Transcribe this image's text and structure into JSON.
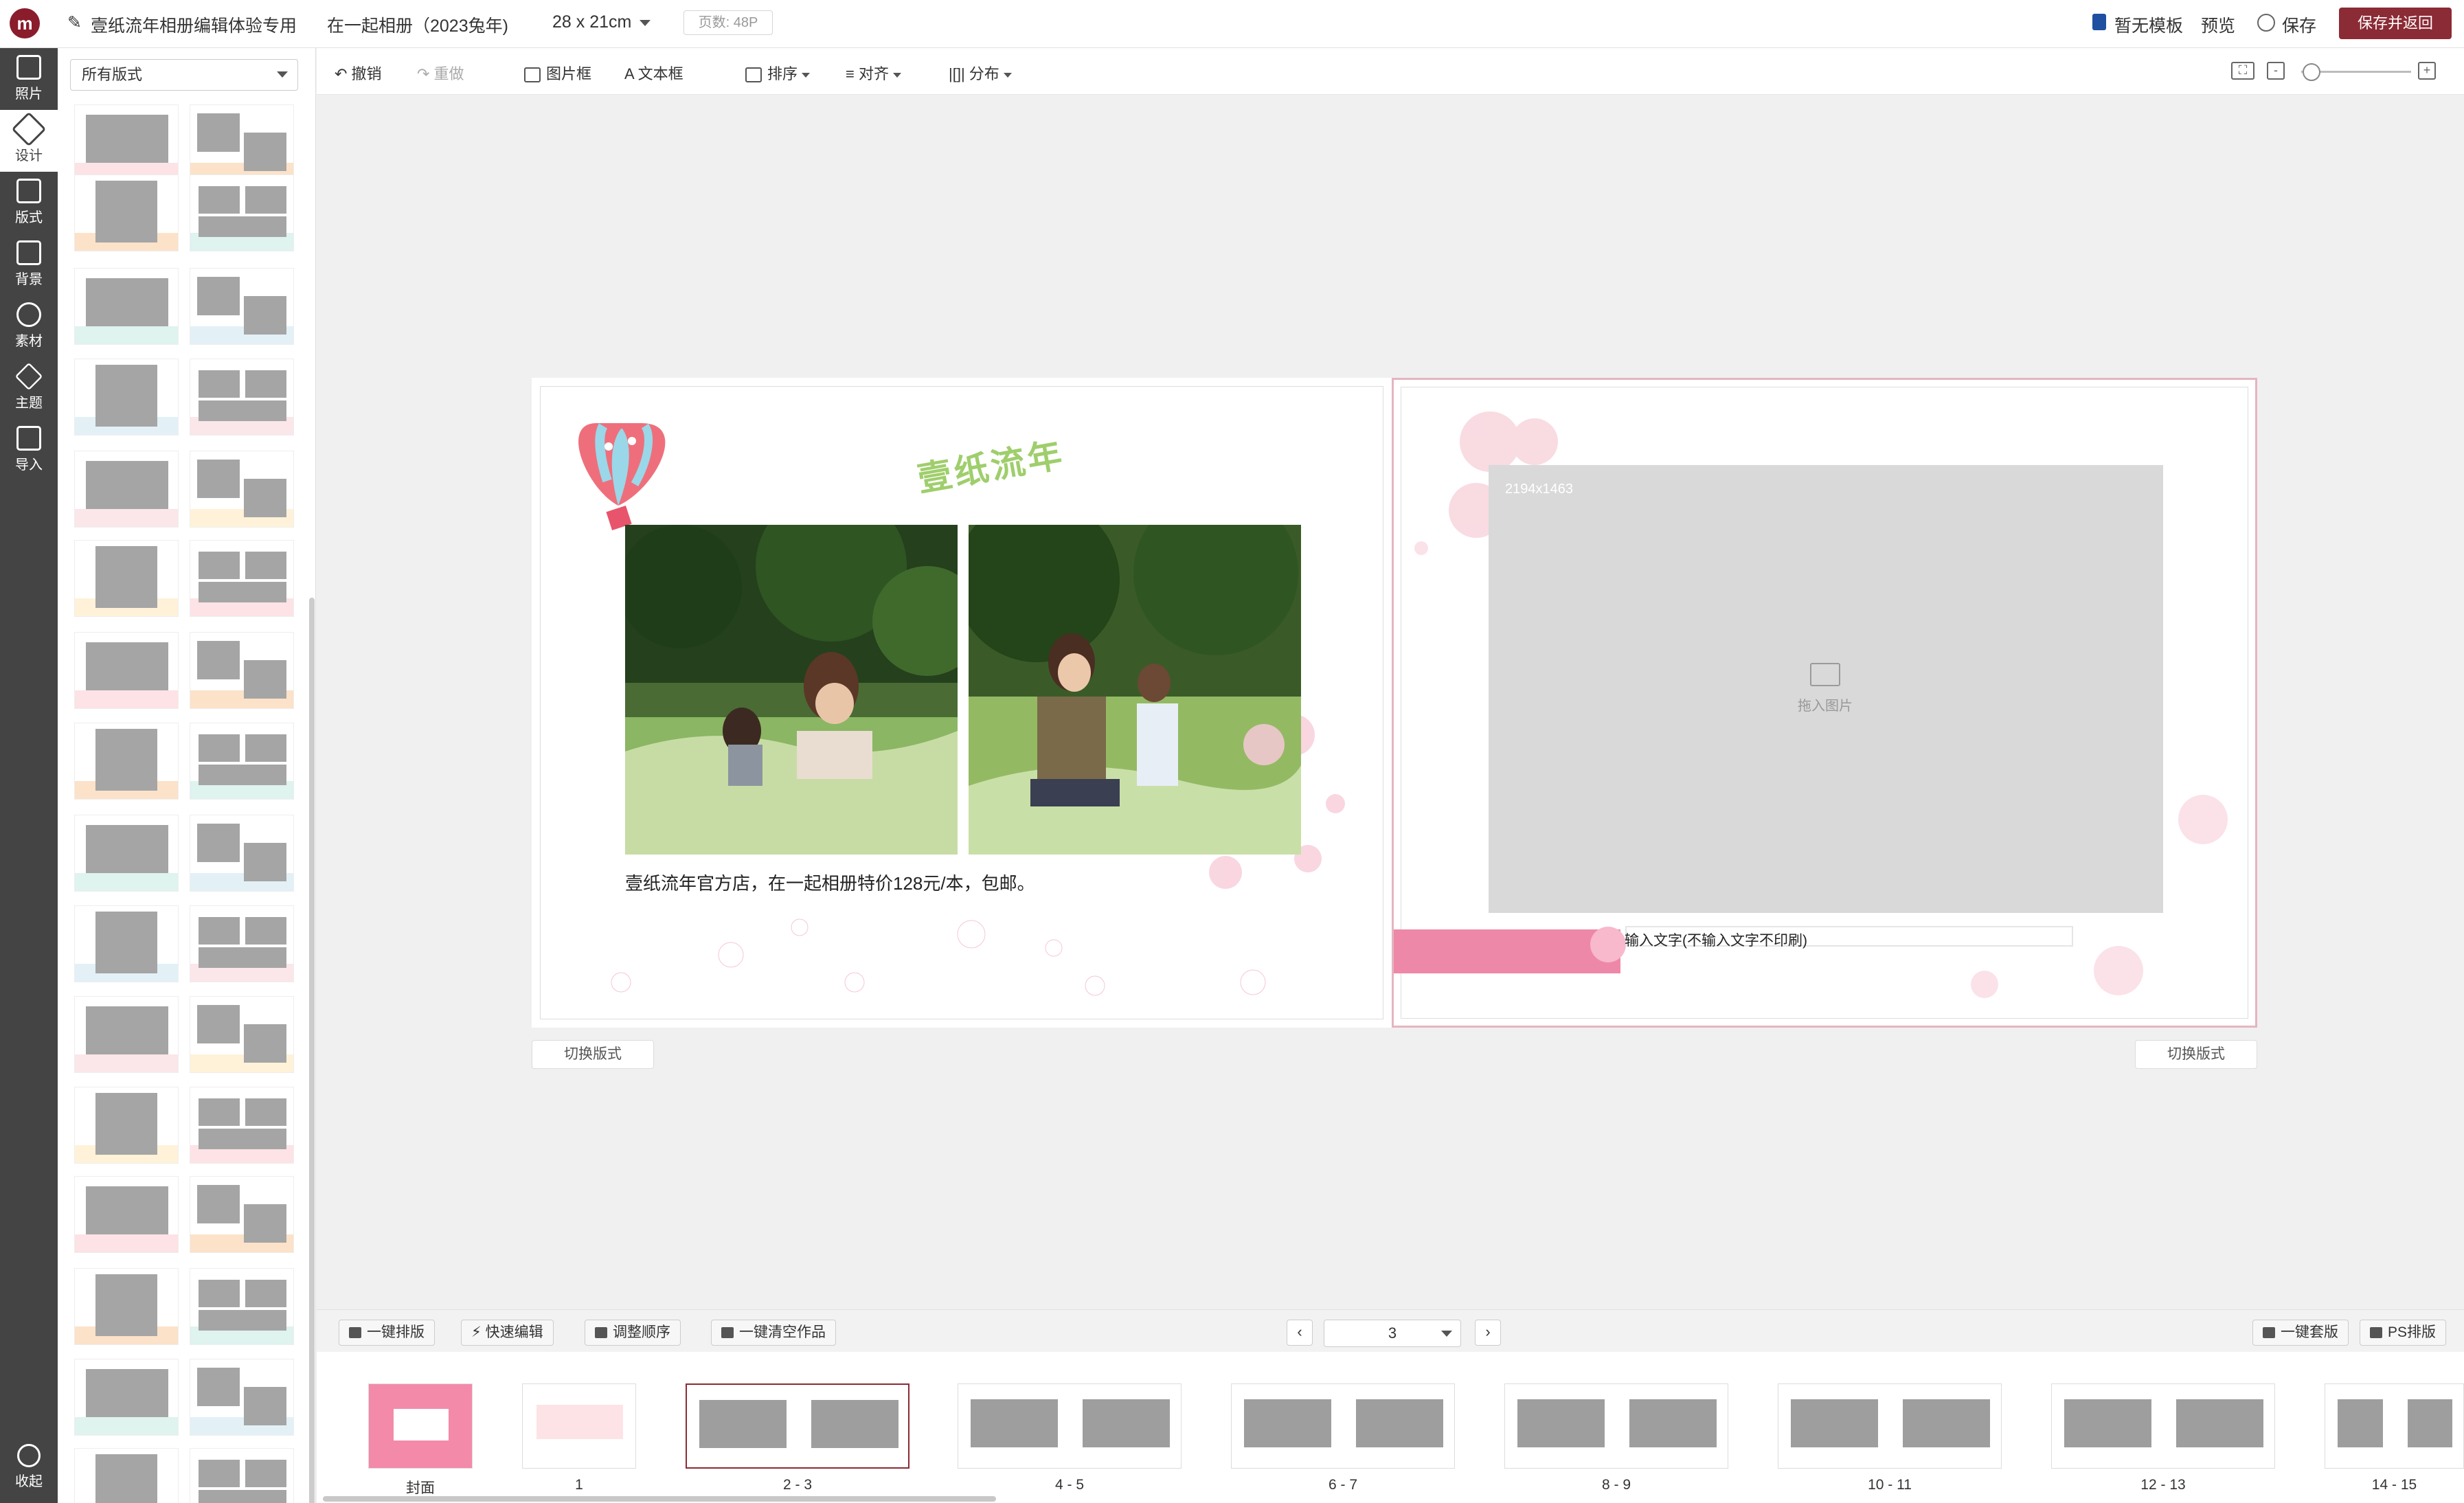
{
  "app": {
    "logo_text": "m",
    "doc_title": "壹纸流年相册编辑体验专用",
    "product": "在一起相册（2023兔年)",
    "size": "28 x 21cm",
    "page_count": "页数: 48P"
  },
  "topbar": {
    "no_template": "暂无模板",
    "preview": "预览",
    "save": "保存",
    "save_return": "保存并返回"
  },
  "rail": [
    {
      "label": "照片",
      "icon": "photo-icon"
    },
    {
      "label": "设计",
      "icon": "design-icon"
    },
    {
      "label": "版式",
      "icon": "layout-icon"
    },
    {
      "label": "背景",
      "icon": "background-icon"
    },
    {
      "label": "素材",
      "icon": "material-icon"
    },
    {
      "label": "主题",
      "icon": "layers-icon"
    },
    {
      "label": "导入",
      "icon": "import-icon"
    }
  ],
  "rail_collapse": "收起",
  "panel": {
    "filter": "所有版式"
  },
  "toolbar": {
    "undo": "撤销",
    "redo": "重做",
    "image_frame": "图片框",
    "text_box": "文本框",
    "arrange": "排序",
    "align": "对齐",
    "distribute": "分布"
  },
  "canvas": {
    "left_page": {
      "headline": "壹纸流年",
      "caption": "壹纸流年官方店，在一起相册特价128元/本，包邮。",
      "switch": "切换版式"
    },
    "right_page": {
      "image_size": "2194x1463",
      "drop_hint": "拖入图片",
      "text_hint": "输入文字(不输入文字不印刷)",
      "switch": "切换版式"
    }
  },
  "bottombar": {
    "auto_layout": "一键排版",
    "quick_edit": "快速编辑",
    "reorder": "调整顺序",
    "clear_all": "一键清空作品",
    "current_page": "3",
    "one_click_set": "一键套版",
    "ps_layout": "PS排版"
  },
  "filmstrip": [
    "封面",
    "1",
    "2 - 3",
    "4 - 5",
    "6 - 7",
    "8 - 9",
    "10 - 11",
    "12 - 13",
    "14 - 15"
  ],
  "colors": {
    "brand": "#8b2b35",
    "rail": "#444444",
    "pink": "#ee88a8",
    "headline_green": "#9fce6c"
  }
}
